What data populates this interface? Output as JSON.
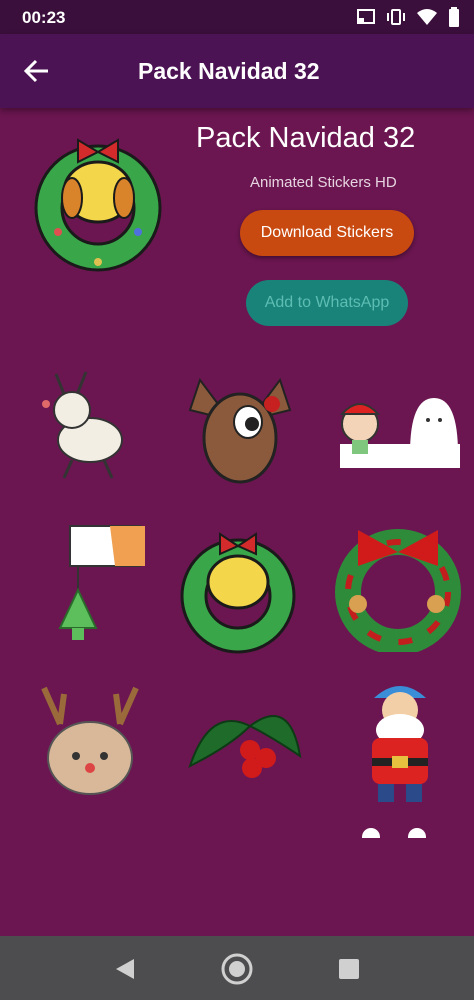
{
  "status": {
    "time": "00:23"
  },
  "appbar": {
    "title": "Pack Navidad 32"
  },
  "pack": {
    "title": "Pack Navidad 32",
    "subtitle": "Animated Stickers HD",
    "download_label": "Download Stickers",
    "whatsapp_label": "Add to WhatsApp"
  },
  "stickers": [
    "reindeer-white-sticker",
    "rudolph-reindeer-sticker",
    "snow-kid-ghost-sticker",
    "cat-paw-ornament-sticker",
    "wreath-hamster-sticker",
    "red-ribbon-wreath-sticker",
    "bear-antlers-sticker",
    "holly-berries-sticker",
    "santa-claus-sticker"
  ],
  "colors": {
    "background": "#6b1650",
    "appbar": "#4b1353",
    "download": "#c94a10",
    "whatsapp": "#19837a"
  }
}
